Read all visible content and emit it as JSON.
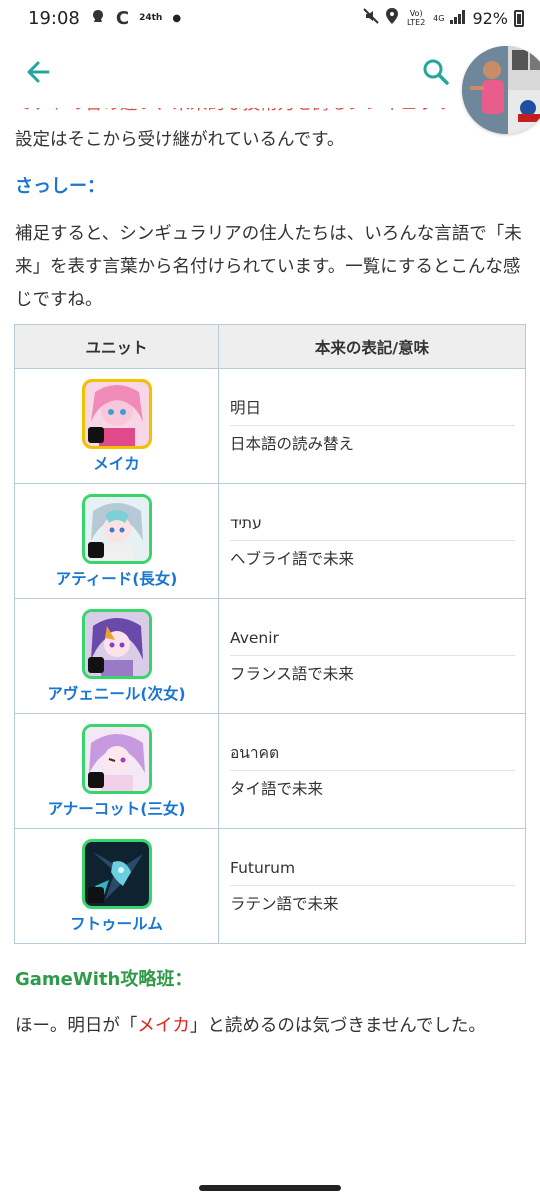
{
  "status": {
    "time": "19:08",
    "clock_badge": "24th",
    "lte": "Vo) LTE2",
    "net": "4G",
    "battery": "92%"
  },
  "appbar": {
    "back_icon": "arrow-left-icon",
    "search_icon": "search-icon",
    "accent": "#26a69a"
  },
  "article": {
    "cut_line": "ミナトの合め違い、未来的な技術力を誇るシンギュラリ",
    "line_inherit": "設定はそこから受け継がれているんです。",
    "speaker1": "さっしー：",
    "para2": "補足すると、シンギュラリアの住人たちは、いろんな言語で「未来」を表す言葉から名付けられています。一覧にするとこんな感じですね。",
    "speaker2": "GameWith攻略班：",
    "para3_a": "ほー。明日が「",
    "para3_red": "メイカ",
    "para3_b": "」と読めるのは気づきませんでした。"
  },
  "table": {
    "headers": [
      "ユニット",
      "本来の表記/意味"
    ],
    "rows": [
      {
        "name": "メイカ",
        "word": "明日",
        "meaning": "日本語の読み替え",
        "frame": "#f2c200"
      },
      {
        "name": "アティード(長女)",
        "word": "עתיד",
        "meaning": "ヘブライ語で未来",
        "frame": "#39d46b"
      },
      {
        "name": "アヴェニール(次女)",
        "word": "Avenir",
        "meaning": "フランス語で未来",
        "frame": "#39d46b"
      },
      {
        "name": "アナーコット(三女)",
        "word": "อนาคต",
        "meaning": "タイ語で未来",
        "frame": "#39d46b"
      },
      {
        "name": "フトゥールム",
        "word": "Futurum",
        "meaning": "ラテン語で未来",
        "frame": "#39d46b"
      }
    ]
  }
}
